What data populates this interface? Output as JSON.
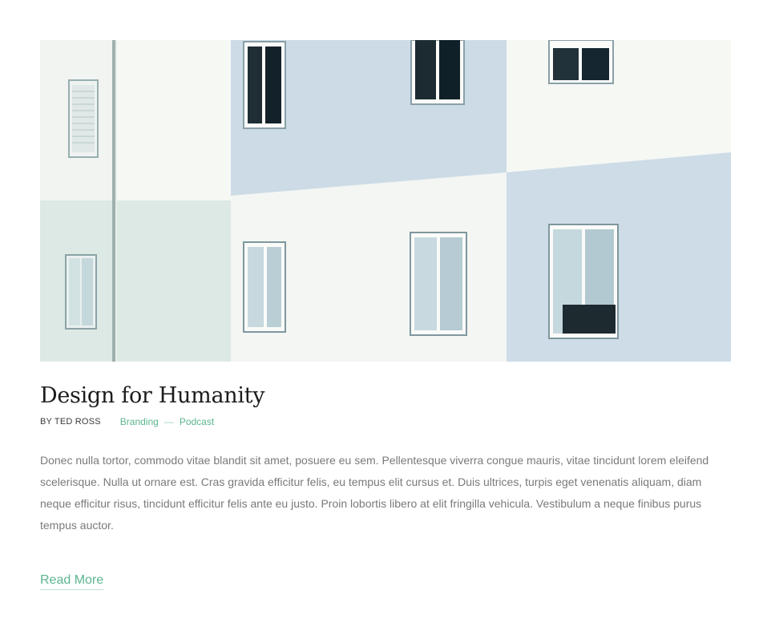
{
  "post": {
    "image_alt": "Building facade with windows",
    "title": "Design for Humanity",
    "author_line": "BY TED ROSS",
    "categories": [
      "Branding",
      "Podcast"
    ],
    "category_separator": "—",
    "excerpt": "Donec nulla tortor, commodo vitae blandit sit amet, posuere eu sem. Pellentesque viverra congue mauris, vitae tincidunt lorem eleifend scelerisque. Nulla ut ornare est. Cras gravida efficitur felis, eu tempus elit cursus et. Duis ultrices, turpis eget venenatis aliquam, diam neque efficitur risus, tincidunt efficitur felis ante eu justo. Proin lobortis libero at elit fringilla vehicula. Vestibulum a neque finibus purus tempus auctor.",
    "read_more_label": "Read More"
  },
  "colors": {
    "accent": "#5bb58e",
    "title": "#1c1c1c",
    "body_text": "#7a7a7a"
  }
}
